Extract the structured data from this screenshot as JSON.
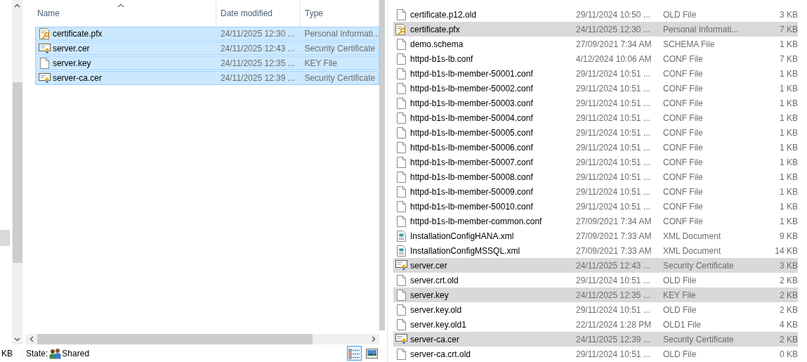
{
  "left_pane": {
    "columns": [
      {
        "label": "Name",
        "sorted": true
      },
      {
        "label": "Date modified",
        "sorted": false
      },
      {
        "label": "Type",
        "sorted": false
      }
    ],
    "rows": [
      {
        "kind": "pfx",
        "name": "certificate.pfx",
        "date": "24/11/2025 12:30 ...",
        "type": "Personal Informati...",
        "selected": true
      },
      {
        "kind": "cert",
        "name": "server.cer",
        "date": "24/11/2025 12:43 ...",
        "type": "Security Certificate",
        "selected": true
      },
      {
        "kind": "file",
        "name": "server.key",
        "date": "24/11/2025 12:35 ...",
        "type": "KEY File",
        "selected": true
      },
      {
        "kind": "cert",
        "name": "server-ca.cer",
        "date": "24/11/2025 12:39 ...",
        "type": "Security Certificate",
        "selected": true
      }
    ]
  },
  "status_bar": {
    "size": "KB",
    "state_label": "State:",
    "state": "Shared",
    "views": [
      {
        "kind": "details",
        "selected": true
      },
      {
        "kind": "large-icons",
        "selected": false
      }
    ]
  },
  "right_pane": {
    "rows": [
      {
        "kind": "file",
        "name": "certificate.p12.old",
        "date": "29/11/2024 10:50 ...",
        "type": "OLD File",
        "size": "3 KB",
        "selected": false
      },
      {
        "kind": "pfx",
        "name": "certificate.pfx",
        "date": "24/11/2025 12:30 ...",
        "type": "Personal Informati...",
        "size": "7 KB",
        "selected": true
      },
      {
        "kind": "file",
        "name": "demo.schema",
        "date": "27/09/2021 7:34 AM",
        "type": "SCHEMA File",
        "size": "1 KB",
        "selected": false
      },
      {
        "kind": "file",
        "name": "httpd-b1s-lb.conf",
        "date": "4/12/2024 10:06 AM",
        "type": "CONF File",
        "size": "7 KB",
        "selected": false
      },
      {
        "kind": "file",
        "name": "httpd-b1s-lb-member-50001.conf",
        "date": "29/11/2024 10:51 ...",
        "type": "CONF File",
        "size": "1 KB",
        "selected": false
      },
      {
        "kind": "file",
        "name": "httpd-b1s-lb-member-50002.conf",
        "date": "29/11/2024 10:51 ...",
        "type": "CONF File",
        "size": "1 KB",
        "selected": false
      },
      {
        "kind": "file",
        "name": "httpd-b1s-lb-member-50003.conf",
        "date": "29/11/2024 10:51 ...",
        "type": "CONF File",
        "size": "1 KB",
        "selected": false
      },
      {
        "kind": "file",
        "name": "httpd-b1s-lb-member-50004.conf",
        "date": "29/11/2024 10:51 ...",
        "type": "CONF File",
        "size": "1 KB",
        "selected": false
      },
      {
        "kind": "file",
        "name": "httpd-b1s-lb-member-50005.conf",
        "date": "29/11/2024 10:51 ...",
        "type": "CONF File",
        "size": "1 KB",
        "selected": false
      },
      {
        "kind": "file",
        "name": "httpd-b1s-lb-member-50006.conf",
        "date": "29/11/2024 10:51 ...",
        "type": "CONF File",
        "size": "1 KB",
        "selected": false
      },
      {
        "kind": "file",
        "name": "httpd-b1s-lb-member-50007.conf",
        "date": "29/11/2024 10:51 ...",
        "type": "CONF File",
        "size": "1 KB",
        "selected": false
      },
      {
        "kind": "file",
        "name": "httpd-b1s-lb-member-50008.conf",
        "date": "29/11/2024 10:51 ...",
        "type": "CONF File",
        "size": "1 KB",
        "selected": false
      },
      {
        "kind": "file",
        "name": "httpd-b1s-lb-member-50009.conf",
        "date": "29/11/2024 10:51 ...",
        "type": "CONF File",
        "size": "1 KB",
        "selected": false
      },
      {
        "kind": "file",
        "name": "httpd-b1s-lb-member-50010.conf",
        "date": "29/11/2024 10:51 ...",
        "type": "CONF File",
        "size": "1 KB",
        "selected": false
      },
      {
        "kind": "file",
        "name": "httpd-b1s-lb-member-common.conf",
        "date": "27/09/2021 7:34 AM",
        "type": "CONF File",
        "size": "1 KB",
        "selected": false
      },
      {
        "kind": "xml",
        "name": "InstallationConfigHANA.xml",
        "date": "27/09/2021 7:33 AM",
        "type": "XML Document",
        "size": "9 KB",
        "selected": false
      },
      {
        "kind": "xml",
        "name": "InstallationConfigMSSQL.xml",
        "date": "27/09/2021 7:33 AM",
        "type": "XML Document",
        "size": "14 KB",
        "selected": false
      },
      {
        "kind": "cert",
        "name": "server.cer",
        "date": "24/11/2025 12:43 ...",
        "type": "Security Certificate",
        "size": "3 KB",
        "selected": true
      },
      {
        "kind": "file",
        "name": "server.crt.old",
        "date": "29/11/2024 10:51 ...",
        "type": "OLD File",
        "size": "2 KB",
        "selected": false
      },
      {
        "kind": "file",
        "name": "server.key",
        "date": "24/11/2025 12:35 ...",
        "type": "KEY File",
        "size": "2 KB",
        "selected": true
      },
      {
        "kind": "file",
        "name": "server.key.old",
        "date": "29/11/2024 10:51 ...",
        "type": "OLD File",
        "size": "2 KB",
        "selected": false
      },
      {
        "kind": "file",
        "name": "server.key.old1",
        "date": "22/11/2024 1:28 PM",
        "type": "OLD1 File",
        "size": "4 KB",
        "selected": false
      },
      {
        "kind": "cert",
        "name": "server-ca.cer",
        "date": "24/11/2025 12:39 ...",
        "type": "Security Certificate",
        "size": "2 KB",
        "selected": true
      },
      {
        "kind": "file",
        "name": "server-ca.crt.old",
        "date": "29/11/2024 10:51 ...",
        "type": "OLD File",
        "size": "0 KB",
        "selected": false
      }
    ]
  }
}
